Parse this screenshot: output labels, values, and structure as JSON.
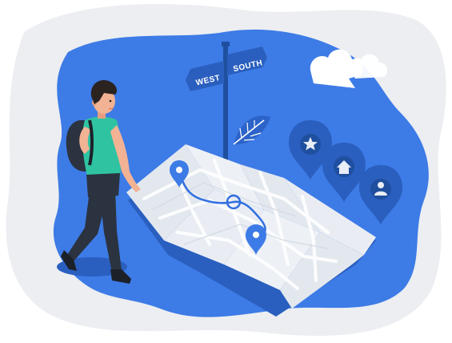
{
  "illustration": {
    "signpost": {
      "left_sign_text": "WEST",
      "right_sign_text": "SOUTH"
    },
    "location_pins": [
      {
        "icon": "star-icon"
      },
      {
        "icon": "home-icon"
      },
      {
        "icon": "person-icon"
      }
    ],
    "colors": {
      "primary_blue": "#3d7be6",
      "dark_blue": "#1f4f9e",
      "light_gray_bg": "#eceef2",
      "map_paper": "#e9edf3",
      "shirt_teal": "#2fc3a2",
      "pants_dark": "#2b3340",
      "skin": "#f2b294",
      "hair": "#2a2320"
    }
  }
}
